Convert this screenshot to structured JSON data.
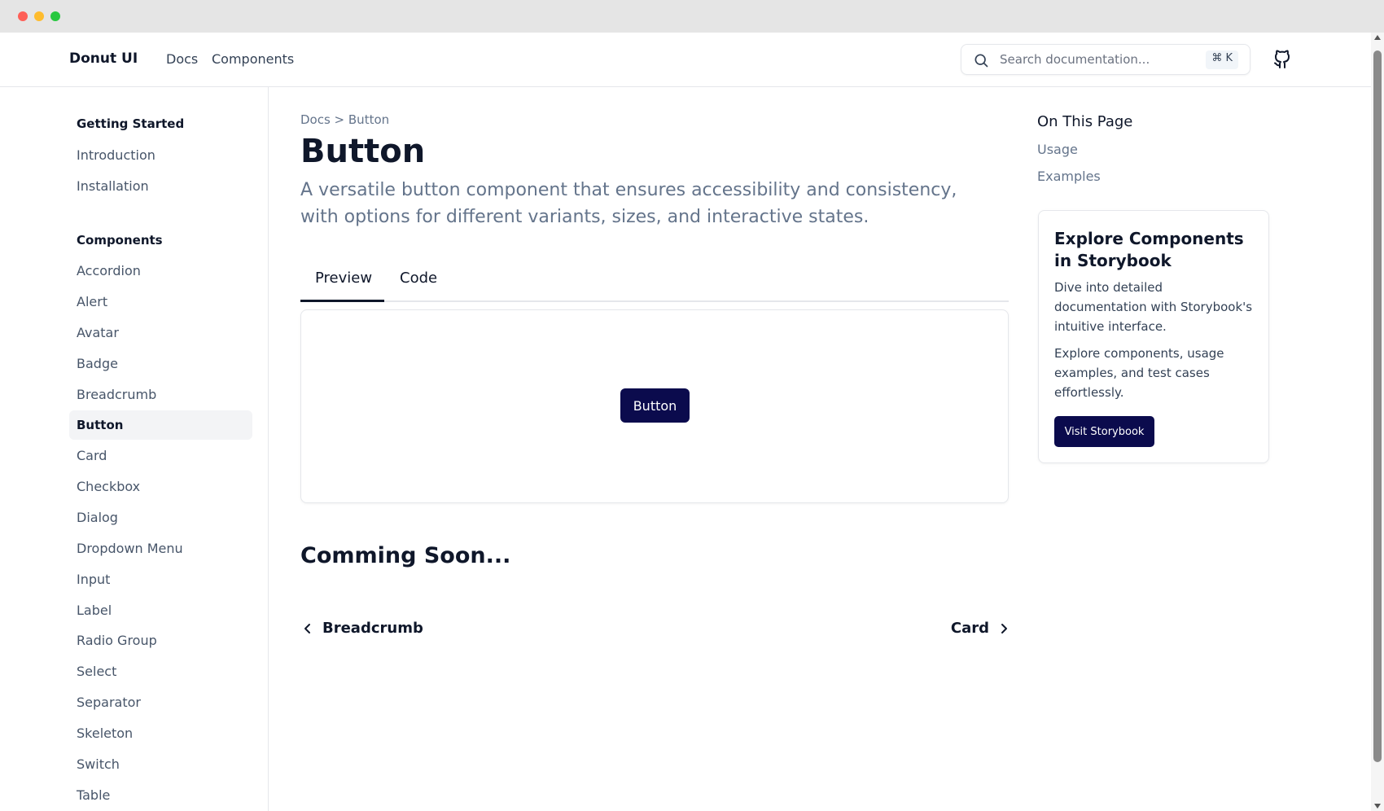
{
  "header": {
    "brand": "Donut UI",
    "nav": [
      "Docs",
      "Components"
    ],
    "search_placeholder": "Search documentation...",
    "shortcut": "⌘ K",
    "github_icon": "github-icon"
  },
  "sidebar": {
    "sections": [
      {
        "heading": "Getting Started",
        "items": [
          "Introduction",
          "Installation"
        ]
      },
      {
        "heading": "Components",
        "items": [
          "Accordion",
          "Alert",
          "Avatar",
          "Badge",
          "Breadcrumb",
          "Button",
          "Card",
          "Checkbox",
          "Dialog",
          "Dropdown Menu",
          "Input",
          "Label",
          "Radio Group",
          "Select",
          "Separator",
          "Skeleton",
          "Switch",
          "Table"
        ]
      }
    ],
    "active_item": "Button"
  },
  "main": {
    "breadcrumb": "Docs > Button",
    "title": "Button",
    "description": "A versatile button component that ensures accessibility and consistency, with options for different variants, sizes, and interactive states.",
    "tabs": [
      "Preview",
      "Code"
    ],
    "demo_button": "Button",
    "coming_soon": "Comming Soon...",
    "prev_label": "Breadcrumb",
    "next_label": "Card"
  },
  "toc": {
    "title": "On This Page",
    "links": [
      "Usage",
      "Examples"
    ]
  },
  "storybook_card": {
    "title": "Explore Components in Storybook",
    "paragraph1": "Dive into detailed documentation with Storybook's intuitive interface.",
    "paragraph2": "Explore components, usage examples, and test cases effortlessly.",
    "button": "Visit Storybook"
  },
  "colors": {
    "primary": "#0b0b4d",
    "muted_text": "#64748b",
    "border": "#e5e7eb"
  }
}
